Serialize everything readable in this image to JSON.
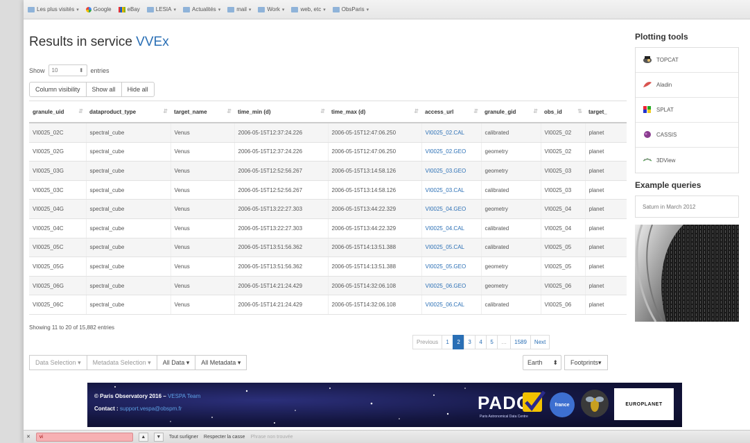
{
  "bookmarks": [
    {
      "label": "Les plus visités",
      "icon": "folder-icon",
      "has_menu": true
    },
    {
      "label": "Google",
      "icon": "google-icon",
      "has_menu": false
    },
    {
      "label": "eBay",
      "icon": "ebay-icon",
      "has_menu": false
    },
    {
      "label": "LESIA",
      "icon": "folder-icon",
      "has_menu": true
    },
    {
      "label": "Actualités",
      "icon": "folder-icon",
      "has_menu": true
    },
    {
      "label": "mail",
      "icon": "folder-icon",
      "has_menu": true
    },
    {
      "label": "Work",
      "icon": "folder-icon",
      "has_menu": true
    },
    {
      "label": "web, etc",
      "icon": "folder-icon",
      "has_menu": true
    },
    {
      "label": "ObsParis",
      "icon": "folder-icon",
      "has_menu": true
    }
  ],
  "page": {
    "title_prefix": "Results in service",
    "service_name": "VVEx"
  },
  "length_menu": {
    "show_label": "Show",
    "value": "10",
    "entries_label": "entries"
  },
  "column_buttons": {
    "visibility": "Column visibility",
    "show_all": "Show all",
    "hide_all": "Hide all"
  },
  "table": {
    "columns": [
      "granule_uid",
      "dataproduct_type",
      "target_name",
      "time_min (d)",
      "time_max (d)",
      "access_url",
      "granule_gid",
      "obs_id",
      "target_"
    ],
    "rows": [
      [
        "VI0025_02C",
        "spectral_cube",
        "Venus",
        "2006-05-15T12:37:24.226",
        "2006-05-15T12:47:06.250",
        "VI0025_02.CAL",
        "calibrated",
        "VI0025_02",
        "planet"
      ],
      [
        "VI0025_02G",
        "spectral_cube",
        "Venus",
        "2006-05-15T12:37:24.226",
        "2006-05-15T12:47:06.250",
        "VI0025_02.GEO",
        "geometry",
        "VI0025_02",
        "planet"
      ],
      [
        "VI0025_03G",
        "spectral_cube",
        "Venus",
        "2006-05-15T12:52:56.267",
        "2006-05-15T13:14:58.126",
        "VI0025_03.GEO",
        "geometry",
        "VI0025_03",
        "planet"
      ],
      [
        "VI0025_03C",
        "spectral_cube",
        "Venus",
        "2006-05-15T12:52:56.267",
        "2006-05-15T13:14:58.126",
        "VI0025_03.CAL",
        "calibrated",
        "VI0025_03",
        "planet"
      ],
      [
        "VI0025_04G",
        "spectral_cube",
        "Venus",
        "2006-05-15T13:22:27.303",
        "2006-05-15T13:44:22.329",
        "VI0025_04.GEO",
        "geometry",
        "VI0025_04",
        "planet"
      ],
      [
        "VI0025_04C",
        "spectral_cube",
        "Venus",
        "2006-05-15T13:22:27.303",
        "2006-05-15T13:44:22.329",
        "VI0025_04.CAL",
        "calibrated",
        "VI0025_04",
        "planet"
      ],
      [
        "VI0025_05C",
        "spectral_cube",
        "Venus",
        "2006-05-15T13:51:56.362",
        "2006-05-15T14:13:51.388",
        "VI0025_05.CAL",
        "calibrated",
        "VI0025_05",
        "planet"
      ],
      [
        "VI0025_05G",
        "spectral_cube",
        "Venus",
        "2006-05-15T13:51:56.362",
        "2006-05-15T14:13:51.388",
        "VI0025_05.GEO",
        "geometry",
        "VI0025_05",
        "planet"
      ],
      [
        "VI0025_06G",
        "spectral_cube",
        "Venus",
        "2006-05-15T14:21:24.429",
        "2006-05-15T14:32:06.108",
        "VI0025_06.GEO",
        "geometry",
        "VI0025_06",
        "planet"
      ],
      [
        "VI0025_06C",
        "spectral_cube",
        "Venus",
        "2006-05-15T14:21:24.429",
        "2006-05-15T14:32:06.108",
        "VI0025_06.CAL",
        "calibrated",
        "VI0025_06",
        "planet"
      ]
    ]
  },
  "info_text": "Showing 11 to 20 of 15,882 entries",
  "pagination": {
    "previous": "Previous",
    "pages": [
      "1",
      "2",
      "3",
      "4",
      "5",
      "…",
      "1589"
    ],
    "active": "2",
    "next": "Next"
  },
  "dropdowns": {
    "data_selection": "Data Selection",
    "metadata_selection": "Metadata Selection",
    "all_data": "All Data",
    "all_metadata": "All Metadata"
  },
  "map_controls": {
    "body": "Earth",
    "footprints": "Footprints"
  },
  "sidebar": {
    "plotting_title": "Plotting tools",
    "tools": [
      {
        "name": "TOPCAT",
        "icon": "topcat-icon"
      },
      {
        "name": "Aladin",
        "icon": "aladin-icon"
      },
      {
        "name": "SPLAT",
        "icon": "splat-icon"
      },
      {
        "name": "CASSIS",
        "icon": "cassis-icon"
      },
      {
        "name": "3DView",
        "icon": "3dview-icon"
      }
    ],
    "examples_title": "Example queries",
    "examples": [
      "Saturn in March 2012"
    ]
  },
  "footer": {
    "copyright": "© Paris Observatory 2016 –",
    "copyright_link": "VESPA Team",
    "contact_label": "Contact :",
    "contact_email": "support.vespa@obspm.fr",
    "padc": "PADC",
    "padc_sub": "Paris Astronomical Data Centre",
    "france": "france",
    "europlanet": "EUROPLANET"
  },
  "findbar": {
    "query": "vi",
    "highlight_all": "Tout surligner",
    "match_case": "Respecter la casse",
    "status": "Phrase non trouvée"
  },
  "colors": {
    "accent": "#2a6fb5",
    "find_error": "#f7b0b3"
  }
}
